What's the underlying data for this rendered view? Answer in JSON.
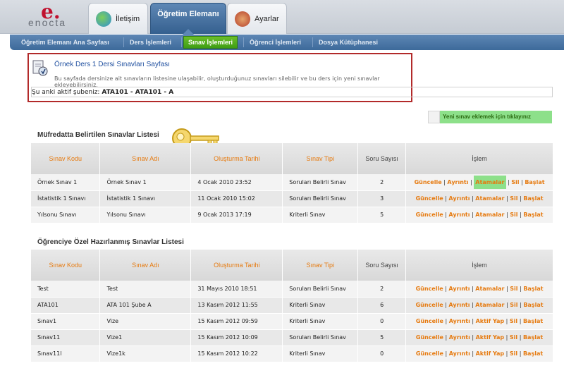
{
  "logo": {
    "mark": "e.",
    "text": "enocta"
  },
  "top_tabs": [
    {
      "label": "İletişim"
    },
    {
      "label": "Öğretim Elemanı"
    },
    {
      "label": "Ayarlar"
    }
  ],
  "subnav": [
    {
      "label": "Öğretim Elemanı Ana Sayfası"
    },
    {
      "label": "Ders İşlemleri"
    },
    {
      "label": "Sınav İşlemleri"
    },
    {
      "label": "Öğrenci İşlemleri"
    },
    {
      "label": "Dosya Kütüphanesi"
    }
  ],
  "page": {
    "title": "Örnek Ders 1 Dersi Sınavları Sayfası",
    "desc": "Bu sayfada dersinize ait sınavların listesine ulaşabilir, oluşturduğunuz sınavları silebilir ve bu ders için yeni sınavlar ekleyebilirsiniz.",
    "branch_label": "Şu anki aktif şubeniz:",
    "branch_value": "ATA101 - ATA101 - A",
    "new_exam": "Yeni sınav eklemek için tıklayınız"
  },
  "headers": {
    "code": "Sınav Kodu",
    "name": "Sınav Adı",
    "date": "Oluşturma Tarihi",
    "type": "Sınav Tipi",
    "count": "Soru Sayısı",
    "action": "İşlem"
  },
  "section1": {
    "title": "Müfredatta Belirtilen Sınavlar Listesi",
    "rows": [
      {
        "code": "Örnek Sınav 1",
        "name": "Örnek Sınav 1",
        "date": "4 Ocak 2010 23:52",
        "type": "Soruları Belirli Sınav",
        "count": "2",
        "act3": "Atamalar"
      },
      {
        "code": "İstatistik 1 Sınavı",
        "name": "İstatistik 1 Sınavı",
        "date": "11 Ocak 2010 15:02",
        "type": "Soruları Belirli Sınav",
        "count": "3",
        "act3": "Atamalar"
      },
      {
        "code": "Yılsonu Sınavı",
        "name": "Yılsonu Sınavı",
        "date": "9 Ocak 2013 17:19",
        "type": "Kriterli Sınav",
        "count": "5",
        "act3": "Atamalar"
      }
    ]
  },
  "section2": {
    "title": "Öğrenciye Özel Hazırlanmış Sınavlar Listesi",
    "rows": [
      {
        "code": "Test",
        "name": "Test",
        "date": "31 Mayıs 2010 18:51",
        "type": "Soruları Belirli Sınav",
        "count": "2",
        "act3": "Atamalar"
      },
      {
        "code": "ATA101",
        "name": "ATA 101 Şube A",
        "date": "13 Kasım 2012 11:55",
        "type": "Kriterli Sınav",
        "count": "6",
        "act3": "Atamalar"
      },
      {
        "code": "Sınav1",
        "name": "Vize",
        "date": "15 Kasım 2012 09:59",
        "type": "Kriterli Sınav",
        "count": "0",
        "act3": "Aktif Yap"
      },
      {
        "code": "Sınav11",
        "name": "Vize1",
        "date": "15 Kasım 2012 10:09",
        "type": "Soruları Belirli Sınav",
        "count": "5",
        "act3": "Aktif Yap"
      },
      {
        "code": "Sınav11l",
        "name": "Vize1k",
        "date": "15 Kasım 2012 10:22",
        "type": "Kriterli Sınav",
        "count": "0",
        "act3": "Aktif Yap"
      }
    ]
  },
  "actions": {
    "update": "Güncelle",
    "detail": "Ayrıntı",
    "delete": "Sil",
    "start": "Başlat"
  }
}
